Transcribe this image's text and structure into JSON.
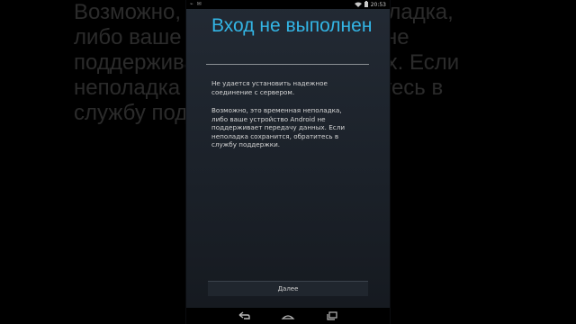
{
  "background": {
    "blurred_text": "Возможно, это временная неполадка,\nлибо ваше устройство Android не\nподдерживает передачу данных. Если\nнеполадка сохранится, обратитесь в\nслужбу поддержки."
  },
  "status_bar": {
    "time": "20:53",
    "icons": [
      "usb-icon",
      "notification-icon",
      "wifi-icon",
      "battery-icon"
    ]
  },
  "dialog": {
    "title": "Вход не выполнен",
    "message_1": "Не удается установить надежное соединение с сервером.",
    "message_2": "Возможно, это временная неполадка, либо ваше устройство Android не поддерживает передачу данных. Если неполадка сохранится, обратитесь в службу поддержки.",
    "next_label": "Далее"
  },
  "nav_bar": {
    "buttons": [
      "back-icon",
      "home-icon",
      "recents-icon"
    ]
  },
  "colors": {
    "accent": "#33b5e5",
    "screen_bg": "#1b2129"
  }
}
